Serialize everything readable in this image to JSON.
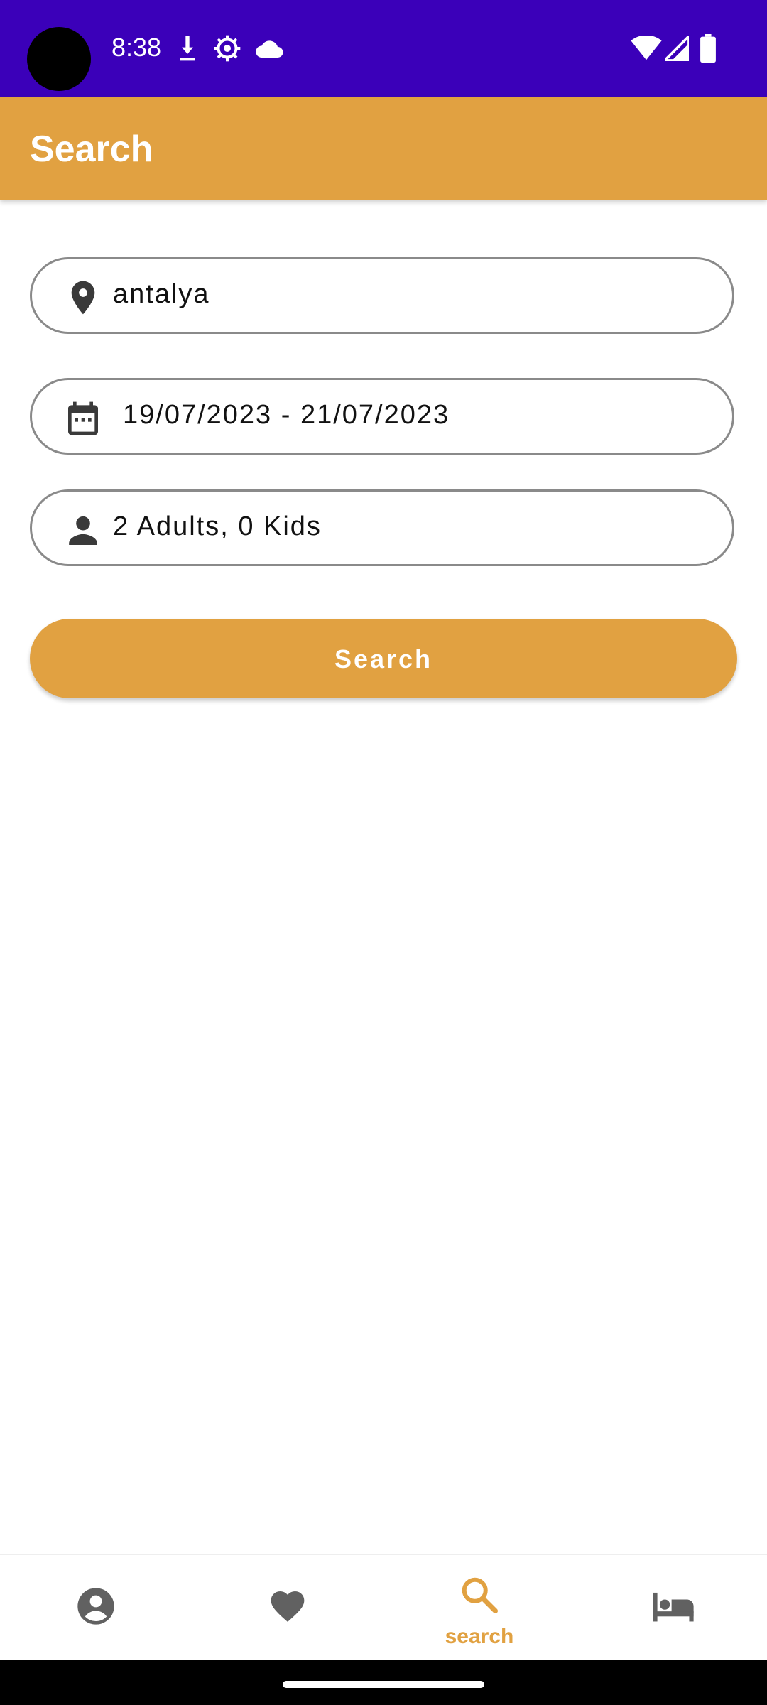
{
  "status_bar": {
    "time": "8:38",
    "icons": [
      "download-icon",
      "settings-gear-icon",
      "cloud-icon",
      "wifi-icon",
      "signal-icon",
      "battery-icon"
    ],
    "background": "#3b00b9"
  },
  "app_bar": {
    "title": "Search",
    "background": "#e1a141"
  },
  "form": {
    "destination": {
      "icon": "location-pin-icon",
      "value": "antalya"
    },
    "dates": {
      "icon": "calendar-icon",
      "value": "19/07/2023 - 21/07/2023"
    },
    "guests": {
      "icon": "person-icon",
      "value": "2 Adults, 0 Kids"
    },
    "search_button": "Search"
  },
  "bottom_nav": {
    "items": [
      {
        "icon": "account-circle-icon",
        "label": "",
        "active": false
      },
      {
        "icon": "heart-icon",
        "label": "",
        "active": false
      },
      {
        "icon": "search-icon",
        "label": "search",
        "active": true
      },
      {
        "icon": "bed-icon",
        "label": "",
        "active": false
      }
    ],
    "active_color": "#e1a141",
    "inactive_color": "#616161"
  }
}
